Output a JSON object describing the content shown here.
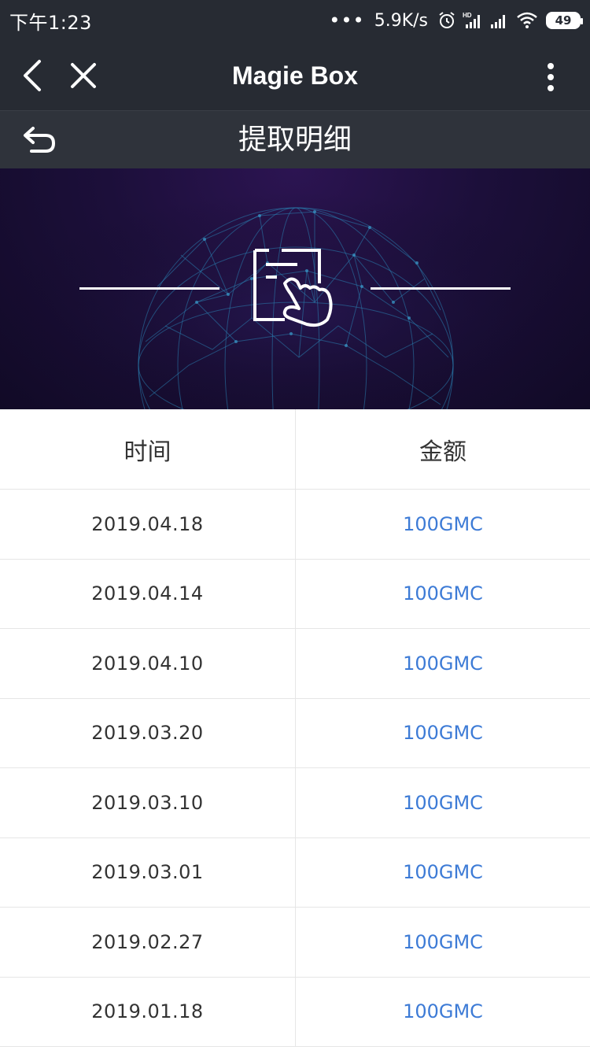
{
  "status_bar": {
    "time": "下午1:23",
    "dots": "•••",
    "speed": "5.9K/s",
    "battery": "49",
    "icons": [
      "alarm-icon",
      "hd-signal-icon",
      "signal-icon",
      "wifi-icon",
      "battery-icon"
    ]
  },
  "nav": {
    "title": "Magie Box",
    "icons": [
      "back-arrow-icon",
      "close-icon",
      "more-vertical-icon"
    ]
  },
  "sub_header": {
    "title": "提取明细",
    "icons": [
      "return-icon"
    ]
  },
  "banner": {
    "icon": "withdraw-hand-icon",
    "colors": {
      "background": "#1c0f3a",
      "globe": "#2a7fb0"
    }
  },
  "table": {
    "headers": {
      "time": "时间",
      "amount": "金额"
    },
    "rows": [
      {
        "date": "2019.04.18",
        "amount": "100GMC"
      },
      {
        "date": "2019.04.14",
        "amount": "100GMC"
      },
      {
        "date": "2019.04.10",
        "amount": "100GMC"
      },
      {
        "date": "2019.03.20",
        "amount": "100GMC"
      },
      {
        "date": "2019.03.10",
        "amount": "100GMC"
      },
      {
        "date": "2019.03.01",
        "amount": "100GMC"
      },
      {
        "date": "2019.02.27",
        "amount": "100GMC"
      },
      {
        "date": "2019.01.18",
        "amount": "100GMC"
      }
    ]
  },
  "colors": {
    "header_bg": "#272b33",
    "amount_text": "#3d7bd6",
    "date_text": "#333333"
  }
}
